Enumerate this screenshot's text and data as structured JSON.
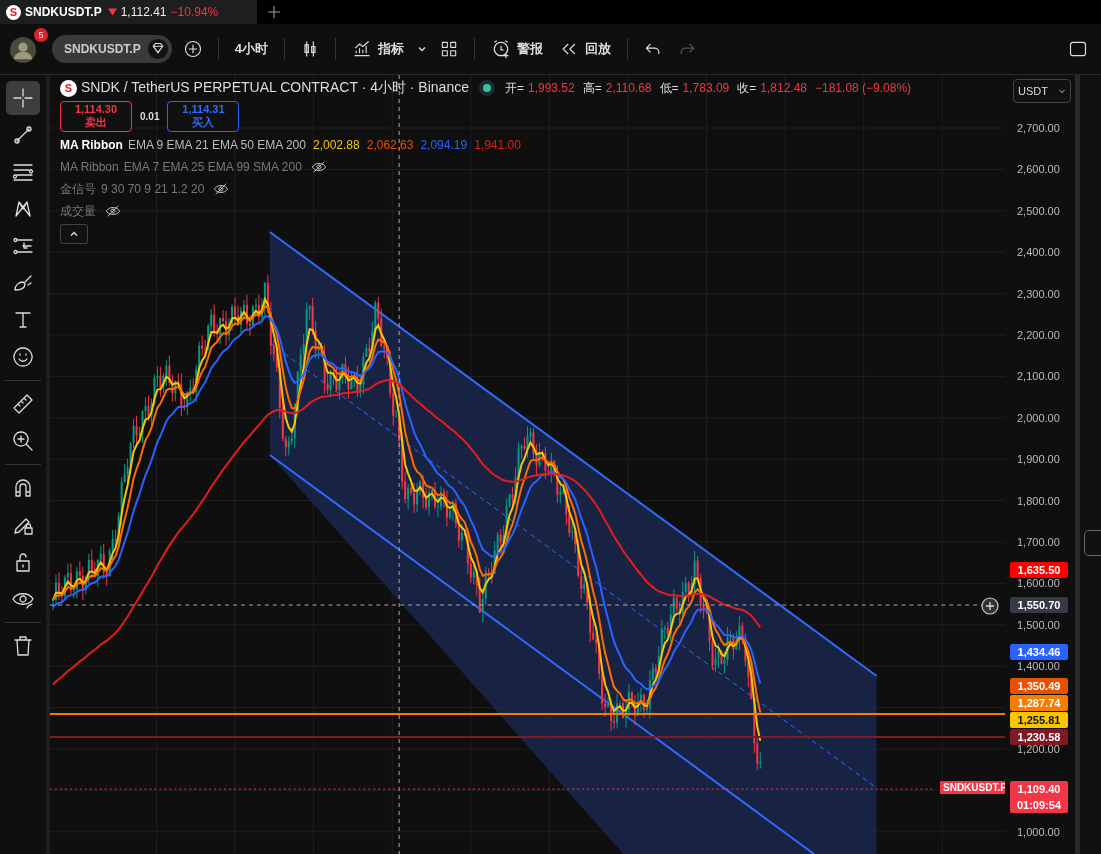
{
  "tab": {
    "logo": "S",
    "symbol": "SNDKUSDT.P",
    "price": "1,112.41",
    "change": "−10.94%"
  },
  "toolbar": {
    "badge": "5",
    "symbol": "SNDKUSDT.P",
    "interval": "4小时",
    "indicators": "指标",
    "alert": "警报",
    "replay": "回放"
  },
  "tools": [
    {
      "selected": true
    },
    {
      "selected": false
    },
    {
      "selected": false
    },
    {
      "selected": false
    },
    {
      "selected": false
    },
    {
      "selected": false
    },
    {
      "selected": false
    },
    {
      "selected": false
    },
    {
      "selected": false
    },
    {
      "selected": false
    },
    {
      "selected": false
    },
    {
      "selected": false
    },
    {
      "selected": false
    },
    {
      "selected": false
    },
    {
      "selected": false
    }
  ],
  "legend": {
    "logo": "S",
    "title": "SNDK / TetherUS PERPETUAL CONTRACT · 4小时 · Binance",
    "ohlc": [
      {
        "label": "开=",
        "value": "1,993.52"
      },
      {
        "label": "高=",
        "value": "2,110.68"
      },
      {
        "label": "低=",
        "value": "1,783.09"
      },
      {
        "label": "收=",
        "value": "1,812.48"
      }
    ],
    "change": "−181.08 (−9.08%)"
  },
  "trade": {
    "sell_price": "1,114.30",
    "sell_label": "卖出",
    "spread": "0.01",
    "buy_price": "1,114.31",
    "buy_label": "买入"
  },
  "indicators": [
    {
      "name": "MA Ribbon",
      "params": "EMA 9 EMA 21 EMA 50 EMA 200",
      "hidden": false,
      "values": [
        {
          "text": "2,002.88",
          "color": "#f7c600"
        },
        {
          "text": "2,062.63",
          "color": "#e65100"
        },
        {
          "text": "2,094.19",
          "color": "#2962ff"
        },
        {
          "text": "1,941.00",
          "color": "#e21d1d"
        }
      ]
    },
    {
      "name": "MA Ribbon",
      "params": "EMA 7 EMA 25 EMA 99 SMA 200",
      "hidden": true
    },
    {
      "name": "金信号",
      "params": "9 30 70 9 21 1.2 20",
      "hidden": true
    },
    {
      "name": "成交量",
      "hidden": true
    }
  ],
  "currency": "USDT",
  "price_axis": [
    "2,700.00",
    "2,600.00",
    "2,500.00",
    "2,400.00",
    "2,300.00",
    "2,200.00",
    "2,100.00",
    "2,000.00",
    "1,900.00",
    "1,800.00",
    "1,700.00",
    "1,600.00",
    "1,500.00",
    "1,400.00",
    "1,200.00",
    "1,000.00"
  ],
  "price_tags": [
    {
      "text": "1,635.50",
      "color": "#ff0000"
    },
    {
      "text": "1,550.70",
      "color": "#363a45"
    },
    {
      "text": "1,434.46",
      "color": "#2962ff"
    },
    {
      "text": "1,350.49",
      "color": "#e65100"
    },
    {
      "text": "1,287.74",
      "color": "#f57c00"
    },
    {
      "text": "1,255.81",
      "color": "#f7c600"
    },
    {
      "text": "1,230.58",
      "color": "#801922"
    },
    {
      "text": "1,109.40",
      "sub": "01:09:54",
      "color": "#f23645"
    }
  ],
  "symbol_tag": "SNDKUSDT.P"
}
